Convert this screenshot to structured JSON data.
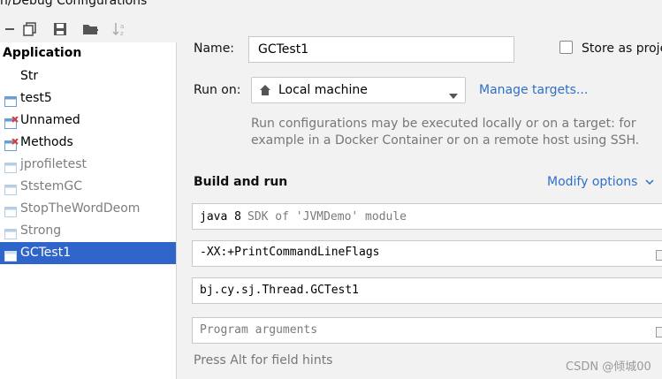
{
  "window": {
    "title": "n/Debug Configurations"
  },
  "toolbar": {
    "icons": [
      "remove-icon",
      "copy-icon",
      "save-icon",
      "new-folder-icon",
      "sort-icon"
    ]
  },
  "sidebar": {
    "header": "Application",
    "items": [
      {
        "label": "Str",
        "icon": "none",
        "state": "normal"
      },
      {
        "label": "test5",
        "icon": "app-config-icon",
        "state": "normal"
      },
      {
        "label": "Unnamed",
        "icon": "app-config-error-icon",
        "state": "normal"
      },
      {
        "label": "Methods",
        "icon": "app-config-error-icon",
        "state": "normal"
      },
      {
        "label": "jprofiletest",
        "icon": "app-config-icon",
        "state": "dim"
      },
      {
        "label": "StstemGC",
        "icon": "app-config-icon",
        "state": "dim"
      },
      {
        "label": "StopTheWordDeom",
        "icon": "app-config-icon",
        "state": "dim"
      },
      {
        "label": "Strong",
        "icon": "app-config-icon",
        "state": "dim"
      },
      {
        "label": "GCTest1",
        "icon": "app-config-icon",
        "state": "selected"
      }
    ]
  },
  "form": {
    "name_label": "Name:",
    "name_value": "GCTest1",
    "store_label": "Store as proje",
    "runon_label": "Run on:",
    "runon_value": "Local machine",
    "manage_targets": "Manage targets...",
    "runon_desc_line1": "Run configurations may be executed locally or on a target: for",
    "runon_desc_line2": "example in a Docker Container or on a remote host using SSH.",
    "section_title": "Build and run",
    "modify_options": "Modify options",
    "jdk_value": "java 8",
    "jdk_hint": "SDK of 'JVMDemo' module",
    "vm_options": "-XX:+PrintCommandLineFlags",
    "main_class": "bj.cy.sj.Thread.GCTest1",
    "program_args_placeholder": "Program arguments",
    "field_hints": "Press Alt for field hints"
  },
  "watermark": "CSDN @倾城00",
  "colors": {
    "selection": "#2f65ca",
    "link": "#2f6fc7",
    "error": "#d83b3b"
  }
}
